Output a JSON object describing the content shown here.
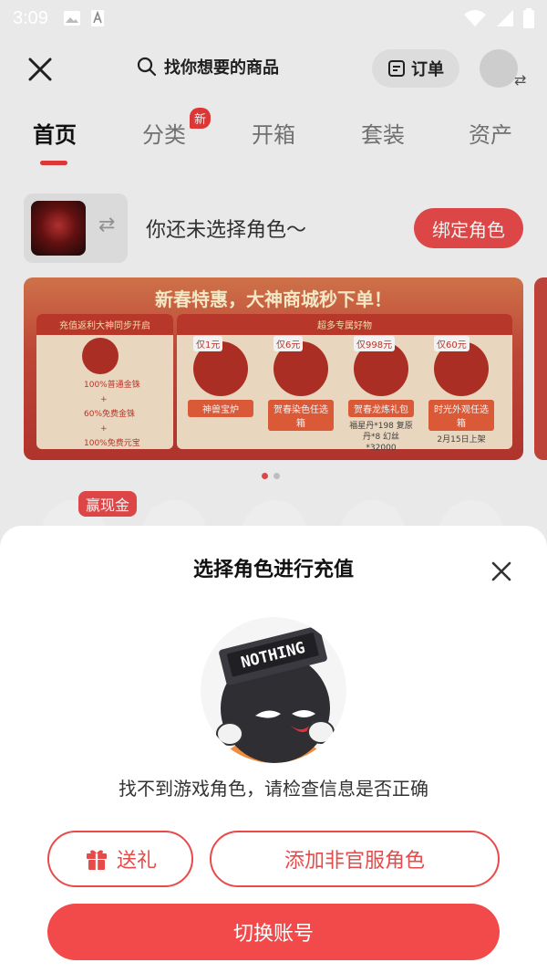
{
  "status_bar": {
    "time": "3:09"
  },
  "header": {
    "search_placeholder": "找你想要的商品",
    "orders_label": "订单"
  },
  "tabs": [
    {
      "label": "首页"
    },
    {
      "label": "分类",
      "badge": "新"
    },
    {
      "label": "开箱"
    },
    {
      "label": "套装"
    },
    {
      "label": "资产"
    }
  ],
  "role_card": {
    "text": "你还未选择角色～",
    "bind_button": "绑定角色"
  },
  "banner": {
    "title": "新春特惠，大神商城秒下单！",
    "left_header": "充值返利大神同步开启",
    "left_rows": [
      "100%普通金铢",
      "+",
      "60%免费金铢",
      "+",
      "100%免费元宝"
    ],
    "right_header": "超多专属好物",
    "products": [
      {
        "price": "仅1元",
        "label": "神兽宝炉"
      },
      {
        "price": "仅6元",
        "label": "贺春染色任选箱"
      },
      {
        "price": "仅998元",
        "label": "贺春龙炼礼包",
        "sub": "福星丹*198 复原丹*8 幻丝*32000"
      },
      {
        "price": "仅60元",
        "label": "时光外观任选箱",
        "sub": "2月15日上架"
      }
    ]
  },
  "quick_actions": {
    "earn_badge": "赢现金"
  },
  "sheet": {
    "title": "选择角色进行充值",
    "mascot_text": "NOTHING",
    "empty_message": "找不到游戏角色，请检查信息是否正确",
    "gift_button": "送礼",
    "add_role_button": "添加非官服角色",
    "switch_button": "切换账号"
  },
  "colors": {
    "accent": "#e84a4a",
    "primary_button": "#f24a4a"
  }
}
